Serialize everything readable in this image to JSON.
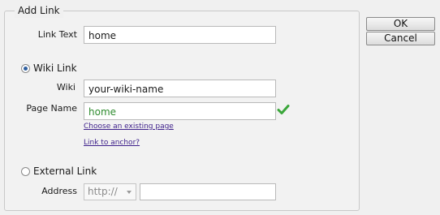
{
  "group": {
    "title": "Add Link"
  },
  "link_text": {
    "label": "Link Text",
    "value": "home"
  },
  "wiki_link": {
    "radio_label": "Wiki Link",
    "selected": true,
    "wiki_label": "Wiki",
    "wiki_value": "your-wiki-name",
    "page_name_label": "Page Name",
    "page_name_value": "home",
    "page_status_icon": "green-check-icon",
    "choose_page_link": "Choose an existing page",
    "anchor_link": "Link to anchor?"
  },
  "external_link": {
    "radio_label": "External Link",
    "selected": false,
    "address_label": "Address",
    "protocol_value": "http://",
    "address_value": ""
  },
  "buttons": {
    "ok": "OK",
    "cancel": "Cancel"
  },
  "colors": {
    "link": "#3d1f8a",
    "success": "#2e8b2e",
    "radio_dot": "#2f5f9f"
  }
}
